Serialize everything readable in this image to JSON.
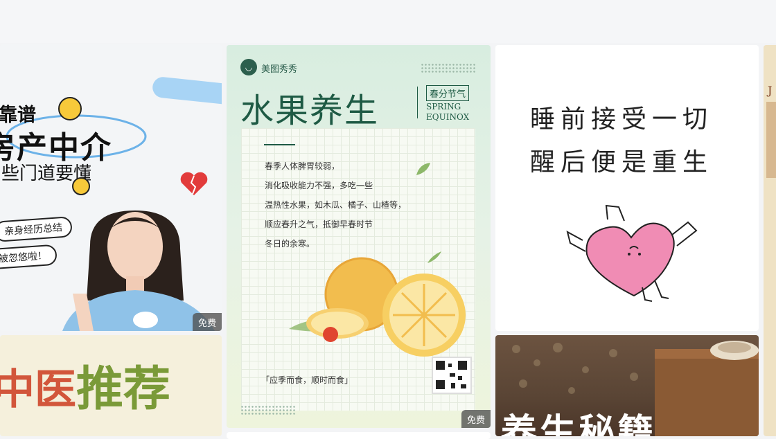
{
  "cards": {
    "realestate": {
      "line1": "靠谱",
      "line2": "房产中介",
      "line3": "些门道要懂",
      "tag1": "亲身经历总结",
      "tag2": "被忽悠啦！",
      "badge": "免费"
    },
    "fruit": {
      "brand": "美图秀秀",
      "title": "水果养生",
      "side_tag": "春分节气",
      "en_line1": "SPRING",
      "en_line2": "EQUINOX",
      "body": [
        "春季人体脾胃较弱，",
        "消化吸收能力不强，多吃一些",
        "温热性水果，如木瓜、橘子、山楂等，",
        "顺应春升之气，抵御早春时节",
        "冬日的余寒。"
      ],
      "footer": "「应季而食，顺时而食」",
      "badge": "免费"
    },
    "quote": {
      "line1": "睡前接受一切",
      "line2": "醒后便是重生"
    },
    "tcm": {
      "red_text": "中医",
      "green_text": "推荐"
    },
    "secret": {
      "title": "养生秘籍"
    },
    "edge": {
      "letter": "J"
    }
  },
  "colors": {
    "fruit_title": "#1e5a44",
    "badge_bg": "#505050",
    "tcm_red": "#d2563b",
    "tcm_green": "#7a9a38"
  }
}
